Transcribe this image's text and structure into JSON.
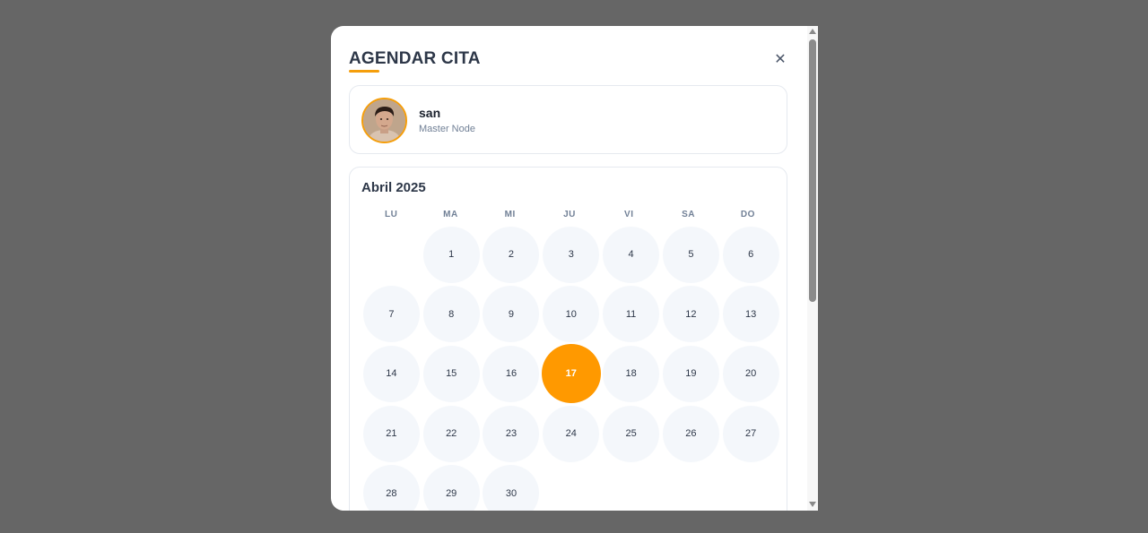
{
  "modal": {
    "title": "AGENDAR CITA",
    "close_label": "✕"
  },
  "profile": {
    "name": "san",
    "role": "Master Node",
    "avatar_icon": "person-avatar"
  },
  "calendar": {
    "month_label": "Abril 2025",
    "weekdays": [
      "LU",
      "MA",
      "MI",
      "JU",
      "VI",
      "SA",
      "DO"
    ],
    "first_day_offset": 1,
    "days": [
      "1",
      "2",
      "3",
      "4",
      "5",
      "6",
      "7",
      "8",
      "9",
      "10",
      "11",
      "12",
      "13",
      "14",
      "15",
      "16",
      "17",
      "18",
      "19",
      "20",
      "21",
      "22",
      "23",
      "24",
      "25",
      "26",
      "27",
      "28",
      "29",
      "30"
    ],
    "selected_day": "17"
  },
  "colors": {
    "accent": "#ff9900",
    "day_bg": "#f4f7fb",
    "overlay": "#666666"
  }
}
